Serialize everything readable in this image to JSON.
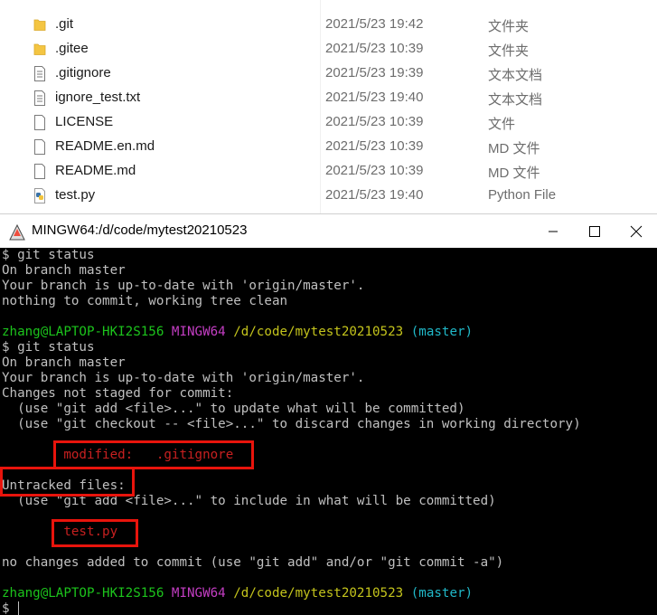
{
  "explorer": {
    "files": [
      {
        "name": ".git",
        "date": "2021/5/23 19:42",
        "type": "文件夹",
        "icon": "folder-icon"
      },
      {
        "name": ".gitee",
        "date": "2021/5/23 10:39",
        "type": "文件夹",
        "icon": "folder-icon"
      },
      {
        "name": ".gitignore",
        "date": "2021/5/23 19:39",
        "type": "文本文档",
        "icon": "text-file-icon"
      },
      {
        "name": "ignore_test.txt",
        "date": "2021/5/23 19:40",
        "type": "文本文档",
        "icon": "text-file-icon"
      },
      {
        "name": "LICENSE",
        "date": "2021/5/23 10:39",
        "type": "文件",
        "icon": "file-icon"
      },
      {
        "name": "README.en.md",
        "date": "2021/5/23 10:39",
        "type": "MD 文件",
        "icon": "file-icon"
      },
      {
        "name": "README.md",
        "date": "2021/5/23 10:39",
        "type": "MD 文件",
        "icon": "file-icon"
      },
      {
        "name": "test.py",
        "date": "2021/5/23 19:40",
        "type": "Python File",
        "icon": "python-file-icon"
      }
    ]
  },
  "terminal": {
    "title": "MINGW64:/d/code/mytest20210523",
    "colors": {
      "user": "#1cc41c",
      "env": "#c43ec4",
      "path": "#c4c41c",
      "branch": "#20b8c8",
      "changed": "#c82020",
      "highlight": "#e8140c"
    },
    "prompt": {
      "user": "zhang@LAPTOP-HKI2S156",
      "env": "MINGW64",
      "path": "/d/code/mytest20210523",
      "branch": "(master)"
    },
    "lines": {
      "l1": "$ git status",
      "l2": "On branch master",
      "l3": "Your branch is up-to-date with 'origin/master'.",
      "l4": "nothing to commit, working tree clean",
      "l6": "$ git status",
      "l7": "On branch master",
      "l8": "Your branch is up-to-date with 'origin/master'.",
      "l9": "Changes not staged for commit:",
      "l10": "  (use \"git add <file>...\" to update what will be committed)",
      "l11": "  (use \"git checkout -- <file>...\" to discard changes in working directory)",
      "l13": "        modified:   .gitignore",
      "l15": "Untracked files:",
      "l16": "  (use \"git add <file>...\" to include in what will be committed)",
      "l18": "        test.py",
      "l20": "no changes added to commit (use \"git add\" and/or \"git commit -a\")",
      "l22": "$ "
    }
  }
}
